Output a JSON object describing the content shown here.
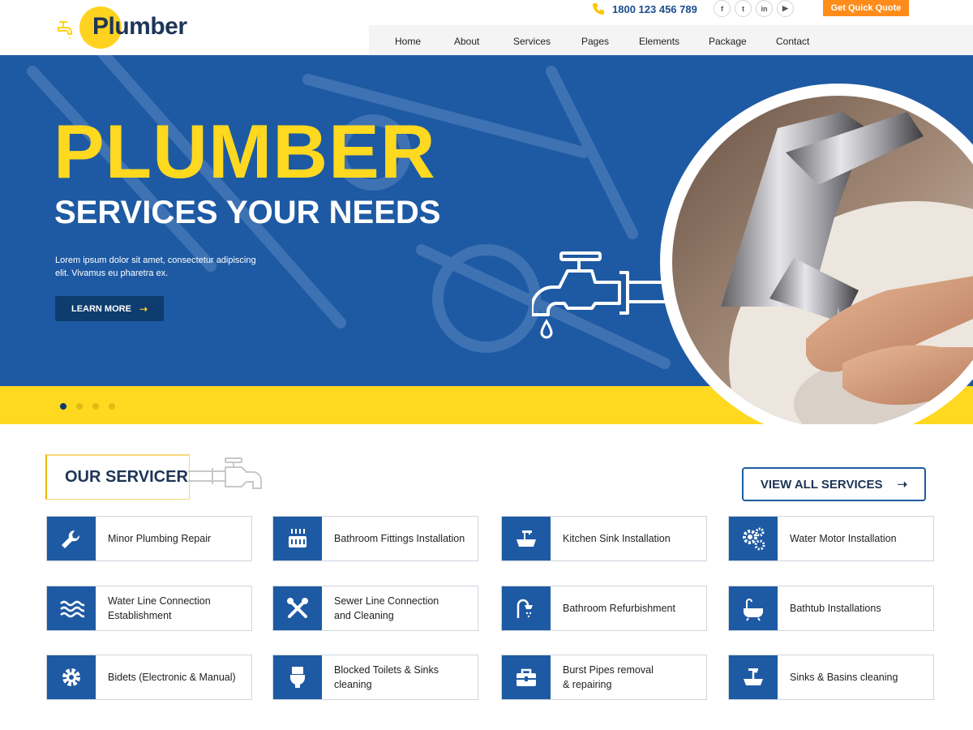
{
  "brand": {
    "name": "Plumber",
    "accent_yellow": "#ffd820",
    "primary_blue": "#1e5aa3",
    "dark_navy": "#0e3c6e",
    "orange": "#ff8c1a"
  },
  "topbar": {
    "phone": "1800 123 456 789",
    "socials": [
      {
        "icon": "facebook-icon",
        "glyph": "f"
      },
      {
        "icon": "twitter-icon",
        "glyph": "t"
      },
      {
        "icon": "linkedin-icon",
        "glyph": "in"
      },
      {
        "icon": "youtube-icon",
        "glyph": "▶"
      }
    ],
    "quote_button": "Get Quick Quote"
  },
  "nav": {
    "items": [
      "Home",
      "About",
      "Services",
      "Pages",
      "Elements",
      "Package",
      "Contact"
    ]
  },
  "hero": {
    "title": "PLUMBER",
    "subtitle": "SERVICES YOUR NEEDS",
    "description": "Lorem ipsum dolor sit amet, consectetur adipiscing elit. Vivamus eu pharetra ex.",
    "button_label": "LEARN MORE",
    "slides": 4,
    "active_slide": 1
  },
  "services": {
    "title": "OUR SERVICER",
    "view_all_label": "VIEW ALL SERVICES",
    "items": [
      {
        "label": "Minor Plumbing Repair",
        "icon": "wrench-icon"
      },
      {
        "label": "Bathroom Fittings Installation",
        "icon": "heater-icon"
      },
      {
        "label": "Kitchen Sink Installation",
        "icon": "sink-icon"
      },
      {
        "label": "Water Motor Installation",
        "icon": "gears-icon"
      },
      {
        "label": "Water Line Connection\nEstablishment",
        "icon": "water-waves-icon"
      },
      {
        "label": "Sewer Line Connection\nand Cleaning",
        "icon": "tools-icon"
      },
      {
        "label": "Bathroom Refurbishment",
        "icon": "shower-icon"
      },
      {
        "label": "Bathtub Installations",
        "icon": "bathtub-icon"
      },
      {
        "label": "Bidets (Electronic & Manual)",
        "icon": "gear-icon"
      },
      {
        "label": "Blocked Toilets & Sinks\ncleaning",
        "icon": "toilet-icon"
      },
      {
        "label": "Burst Pipes removal\n& repairing",
        "icon": "toolbox-icon"
      },
      {
        "label": "Sinks & Basins cleaning",
        "icon": "basin-icon"
      }
    ]
  }
}
